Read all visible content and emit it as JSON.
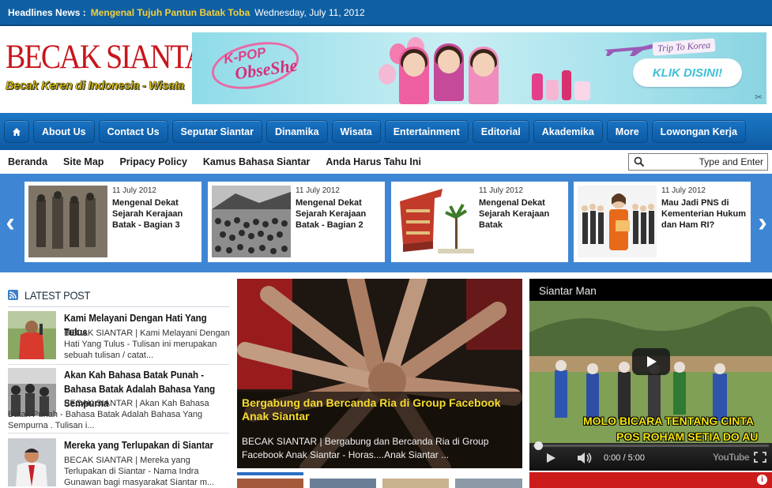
{
  "headline": {
    "label": "Headlines News :",
    "title": "Mengenal Tujuh Pantun Batak Toba",
    "date": "Wednesday, July 11, 2012"
  },
  "header": {
    "logo_main": "BECAK SIANTAR",
    "logo_sub": "Becak Keren di Indonesia - Wisata",
    "banner": {
      "brand_line1": "K-POP",
      "brand_line2": "ObseShe",
      "trip": "Trip To Korea",
      "cta": "KLIK DISINI!"
    }
  },
  "main_nav": {
    "items": [
      "About Us",
      "Contact Us",
      "Seputar Siantar",
      "Dinamika",
      "Wisata",
      "Entertainment",
      "Editorial",
      "Akademika",
      "More",
      "Lowongan Kerja"
    ]
  },
  "sub_nav": {
    "items": [
      "Beranda",
      "Site Map",
      "Pripacy Policy",
      "Kamus Bahasa Siantar",
      "Anda Harus Tahu Ini"
    ]
  },
  "search": {
    "placeholder": "Type and Enter"
  },
  "carousel": {
    "items": [
      {
        "date": "11 July 2012",
        "title": "Mengenal Dekat Sejarah Kerajaan Batak - Bagian 3"
      },
      {
        "date": "11 July 2012",
        "title": "Mengenal Dekat Sejarah Kerajaan Batak - Bagian 2"
      },
      {
        "date": "11 July 2012",
        "title": "Mengenal Dekat Sejarah Kerajaan Batak"
      },
      {
        "date": "11 July 2012",
        "title": "Mau Jadi PNS di Kementerian Hukum dan Ham RI?"
      }
    ]
  },
  "latest": {
    "heading": "LATEST POST",
    "posts": [
      {
        "title": "Kami Melayani Dengan Hati Yang Tulus",
        "excerpt": "BECAK SIANTAR | Kami Melayani Dengan Hati Yang Tulus - Tulisan ini merupakan sebuah tulisan / catat..."
      },
      {
        "title": "Akan Kah Bahasa Batak Punah - Bahasa Batak Adalah Bahasa Yang Sempurna",
        "excerpt": "BECAK SIANTAR | Akan Kah Bahasa Batak Punah - Bahasa Batak Adalah Bahasa Yang Sempurna . Tulisan i..."
      },
      {
        "title": "Mereka yang Terlupakan di Siantar",
        "excerpt": "BECAK SIANTAR | Mereka yang Terlupakan di Siantar - Nama Indra Gunawan bagi masyarakat Siantar m..."
      }
    ]
  },
  "featured": {
    "title": "Bergabung dan Bercanda Ria di Group Facebook Anak Siantar",
    "excerpt": "BECAK SIANTAR | Bergabung dan Bercanda Ria di Group Facebook Anak Siantar - Horas....Anak Siantar ..."
  },
  "video": {
    "title": "Siantar Man",
    "caption_line1": "MOLO BICARA TENTANG CINTA",
    "caption_line2": "POS ROHAM SETIA DO AU",
    "time": "0:00 / 5:00",
    "brand": "YouTube",
    "progress": 0
  },
  "colors": {
    "nav_blue": "#0f5fa3",
    "carousel_blue": "#3e86d4",
    "headline_yellow": "#f5d03a",
    "logo_red": "#c7161c",
    "featured_title": "#f6dc2d"
  }
}
